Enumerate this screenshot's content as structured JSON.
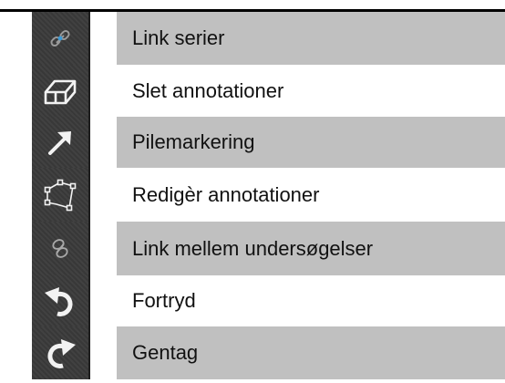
{
  "tools": [
    {
      "label": "Link serier",
      "icon": "link-series-icon",
      "shaded": true
    },
    {
      "label": "Slet annotationer",
      "icon": "eraser-icon",
      "shaded": false
    },
    {
      "label": "Pilemarkering",
      "icon": "arrow-icon",
      "shaded": true
    },
    {
      "label": "Redigèr annotationer",
      "icon": "edit-polygon-icon",
      "shaded": false
    },
    {
      "label": "Link mellem undersøgelser",
      "icon": "link-exams-icon",
      "shaded": true
    },
    {
      "label": "Fortryd",
      "icon": "undo-icon",
      "shaded": false
    },
    {
      "label": "Gentag",
      "icon": "redo-icon",
      "shaded": true
    }
  ],
  "colors": {
    "icon_strip": "#3a3a3a",
    "icon_glyph": "#f2f2f2",
    "row_shade": "#c0c0c0",
    "rule": "#000000"
  }
}
